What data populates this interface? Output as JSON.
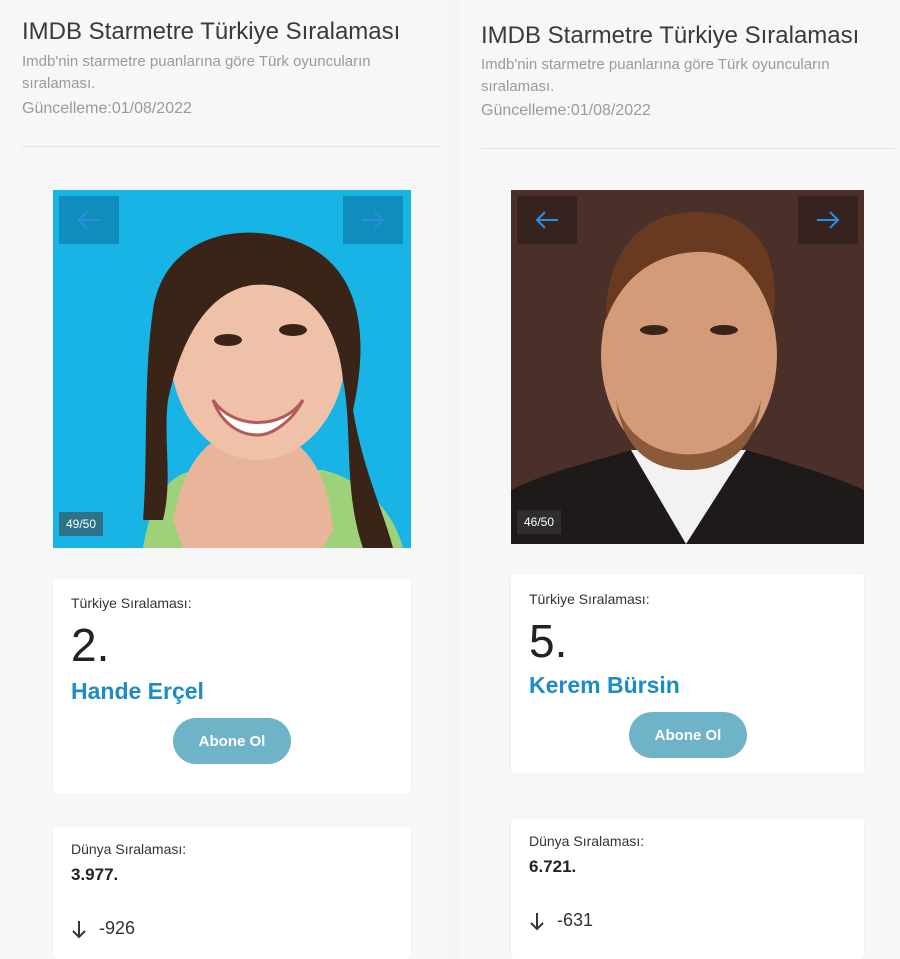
{
  "left": {
    "header": {
      "title": "IMDB Starmetre Türkiye Sıralaması",
      "subtitle": "Imdb'nin starmetre puanlarına göre Türk oyuncuların sıralaması.",
      "updated": "Güncelleme:01/08/2022"
    },
    "gallery": {
      "counter": "49/50",
      "prev_icon": "arrow-left-icon",
      "next_icon": "arrow-right-icon",
      "bg": "#19b4e6"
    },
    "rank_card": {
      "label": "Türkiye Sıralaması:",
      "rank": "2.",
      "name": "Hande Erçel",
      "button": "Abone Ol"
    },
    "world_card": {
      "label": "Dünya Sıralaması:",
      "rank": "3.977.",
      "change": "-926",
      "change_icon": "arrow-down-icon"
    }
  },
  "right": {
    "header": {
      "title": "IMDB Starmetre Türkiye Sıralaması",
      "subtitle": "Imdb'nin starmetre puanlarına göre Türk oyuncuların sıralaması.",
      "updated": "Güncelleme:01/08/2022"
    },
    "gallery": {
      "counter": "46/50",
      "prev_icon": "arrow-left-icon",
      "next_icon": "arrow-right-icon",
      "bg": "#4a3028"
    },
    "rank_card": {
      "label": "Türkiye Sıralaması:",
      "rank": "5.",
      "name": "Kerem Bürsin",
      "button": "Abone Ol"
    },
    "world_card": {
      "label": "Dünya Sıralaması:",
      "rank": "6.721.",
      "change": "-631",
      "change_icon": "arrow-down-icon"
    }
  },
  "colors": {
    "accent": "#1b8cc6",
    "button": "#6fb3c8",
    "arrow": "#2a8fe0"
  }
}
